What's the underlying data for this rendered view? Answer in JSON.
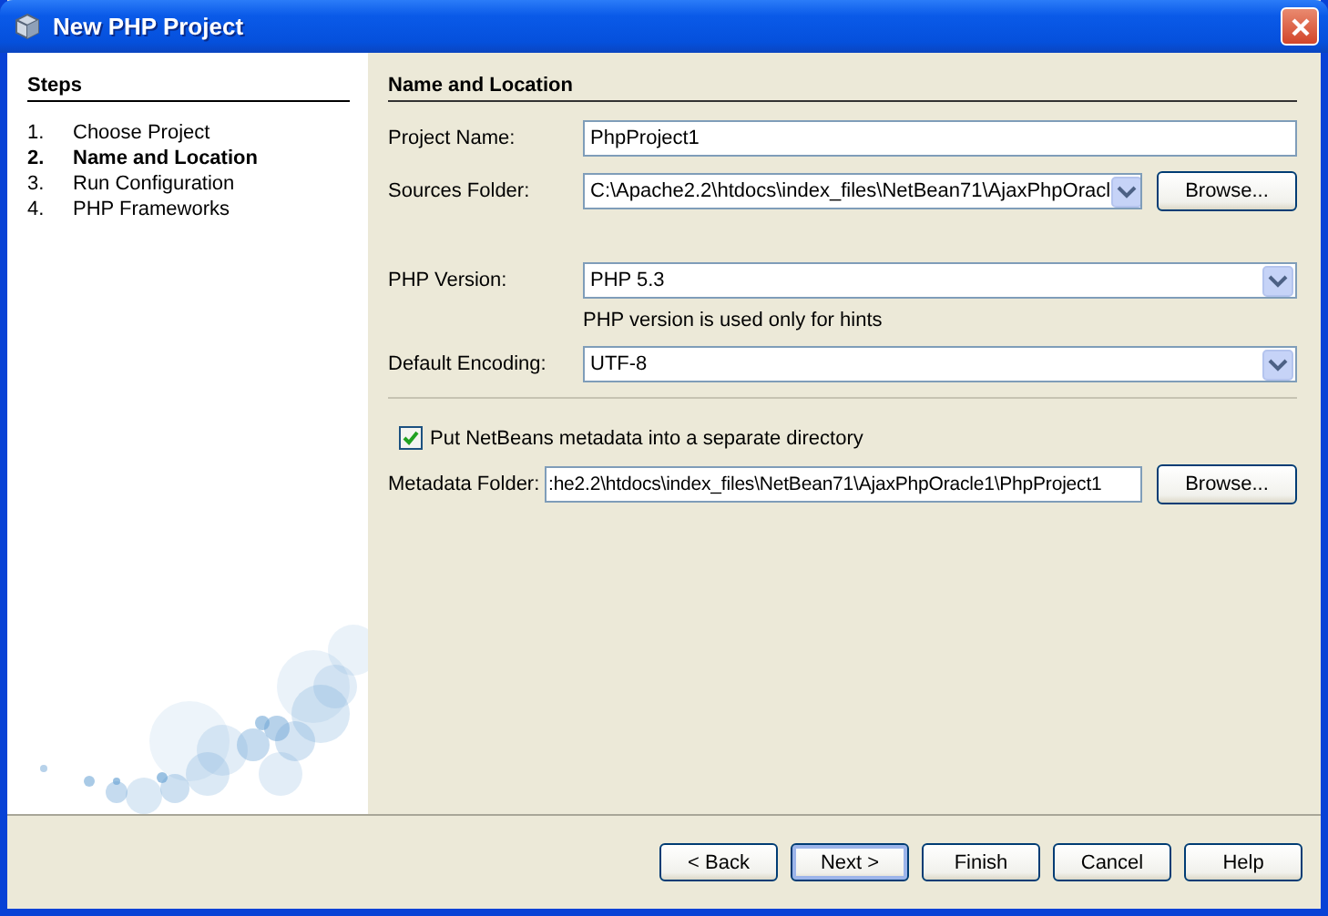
{
  "window": {
    "title": "New PHP Project"
  },
  "steps": {
    "title": "Steps",
    "items": [
      {
        "number": "1.",
        "label": "Choose Project",
        "selected": false
      },
      {
        "number": "2.",
        "label": "Name and Location",
        "selected": true
      },
      {
        "number": "3.",
        "label": "Run Configuration",
        "selected": false
      },
      {
        "number": "4.",
        "label": "PHP Frameworks",
        "selected": false
      }
    ]
  },
  "panel": {
    "title": "Name and Location",
    "rows": [
      {
        "kind": "text",
        "label": "Project Name:",
        "value": "PhpProject1"
      },
      {
        "kind": "combo_browse",
        "label": "Sources Folder:",
        "value": "C:\\Apache2.2\\htdocs\\index_files\\NetBean71\\AjaxPhpOracl",
        "button": "Browse..."
      },
      {
        "kind": "combo",
        "label": "PHP Version:",
        "value": "PHP 5.3"
      },
      {
        "kind": "hint",
        "text": "PHP version is used only for hints"
      },
      {
        "kind": "combo",
        "label": "Default Encoding:",
        "value": "UTF-8"
      },
      {
        "kind": "checkbox",
        "label": "Put NetBeans metadata into a separate directory",
        "checked": true
      },
      {
        "kind": "text_browse",
        "label": "Metadata Folder:",
        "value": ":he2.2\\htdocs\\index_files\\NetBean71\\AjaxPhpOracle1\\PhpProject1",
        "button": "Browse..."
      }
    ]
  },
  "buttons": [
    {
      "label": "< Back",
      "default": false
    },
    {
      "label": "Next >",
      "default": true
    },
    {
      "label": "Finish",
      "default": false
    },
    {
      "label": "Cancel",
      "default": false
    },
    {
      "label": "Help",
      "default": false
    }
  ]
}
